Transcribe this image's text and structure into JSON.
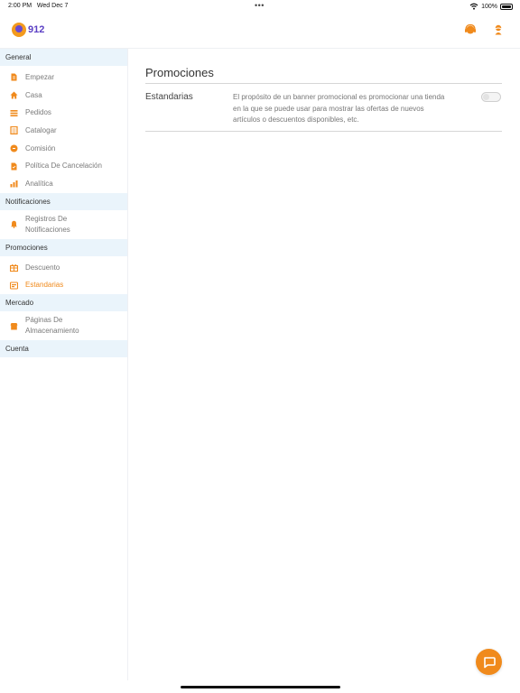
{
  "status_bar": {
    "time": "2:00 PM",
    "date": "Wed Dec 7",
    "dots": "•••",
    "battery": "100%"
  },
  "header": {
    "logo_text": "912",
    "icons": [
      "support-agent-icon",
      "user-avatar-icon"
    ]
  },
  "colors": {
    "accent": "#f08a1c",
    "brand_purple": "#5b3fc4",
    "section_bg": "#eaf4fb"
  },
  "sidebar": {
    "sections": [
      {
        "title": "General",
        "items": [
          {
            "label": "Empezar",
            "icon": "doc-icon"
          },
          {
            "label": "Casa",
            "icon": "home-icon"
          },
          {
            "label": "Pedidos",
            "icon": "list-icon"
          },
          {
            "label": "Catalogar",
            "icon": "catalog-icon"
          },
          {
            "label": "Comisión",
            "icon": "coin-icon"
          },
          {
            "label": "Política De Cancelación",
            "icon": "policy-icon"
          },
          {
            "label": "Analítica",
            "icon": "chart-icon"
          }
        ]
      },
      {
        "title": "Notificaciones",
        "items": [
          {
            "label": "Registros De Notificaciones",
            "icon": "bell-icon"
          }
        ]
      },
      {
        "title": "Promociones",
        "items": [
          {
            "label": "Descuento",
            "icon": "discount-icon"
          },
          {
            "label": "Estandarias",
            "icon": "banner-icon",
            "active": true
          }
        ]
      },
      {
        "title": "Mercado",
        "items": [
          {
            "label": "Páginas De Almacenamiento",
            "icon": "store-icon"
          }
        ]
      },
      {
        "title": "Cuenta",
        "items": []
      }
    ]
  },
  "main": {
    "title": "Promociones",
    "rows": [
      {
        "label": "Estandarias",
        "description": "El propósito de un banner promocional es promocionar una tienda en la que se puede usar para mostrar las ofertas de nuevos artículos o descuentos disponibles, etc.",
        "toggle_on": false
      }
    ]
  }
}
